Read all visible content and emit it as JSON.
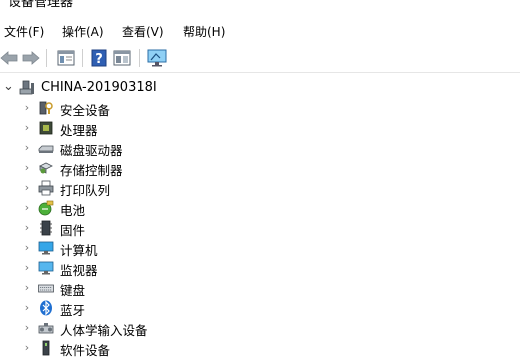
{
  "window": {
    "title": "设备管理器"
  },
  "menu": [
    {
      "label": "文件(F)"
    },
    {
      "label": "操作(A)"
    },
    {
      "label": "查看(V)"
    },
    {
      "label": "帮助(H)"
    }
  ],
  "toolbar": {
    "buttons": [
      {
        "icon": "back-arrow-icon"
      },
      {
        "icon": "forward-arrow-icon"
      },
      {
        "icon": "properties-icon"
      },
      {
        "icon": "help-icon"
      },
      {
        "icon": "update-driver-icon"
      },
      {
        "icon": "scan-hardware-icon"
      }
    ]
  },
  "tree": {
    "root": {
      "label": "CHINA-20190318I",
      "expander": "⌄",
      "icon": "computer-icon"
    },
    "children": [
      {
        "label": "安全设备",
        "icon": "security-device-icon",
        "expander": "›"
      },
      {
        "label": "处理器",
        "icon": "processor-icon",
        "expander": "›"
      },
      {
        "label": "磁盘驱动器",
        "icon": "disk-drive-icon",
        "expander": "›"
      },
      {
        "label": "存储控制器",
        "icon": "storage-controller-icon",
        "expander": "›"
      },
      {
        "label": "打印队列",
        "icon": "printer-icon",
        "expander": "›"
      },
      {
        "label": "电池",
        "icon": "battery-icon",
        "expander": "›"
      },
      {
        "label": "固件",
        "icon": "firmware-icon",
        "expander": "›"
      },
      {
        "label": "计算机",
        "icon": "monitor-icon",
        "expander": "›"
      },
      {
        "label": "监视器",
        "icon": "monitor-icon",
        "expander": "›"
      },
      {
        "label": "键盘",
        "icon": "keyboard-icon",
        "expander": "›"
      },
      {
        "label": "蓝牙",
        "icon": "bluetooth-icon",
        "expander": "›"
      },
      {
        "label": "人体学输入设备",
        "icon": "hid-icon",
        "expander": "›"
      },
      {
        "label": "软件设备",
        "icon": "software-device-icon",
        "expander": "›"
      }
    ]
  }
}
